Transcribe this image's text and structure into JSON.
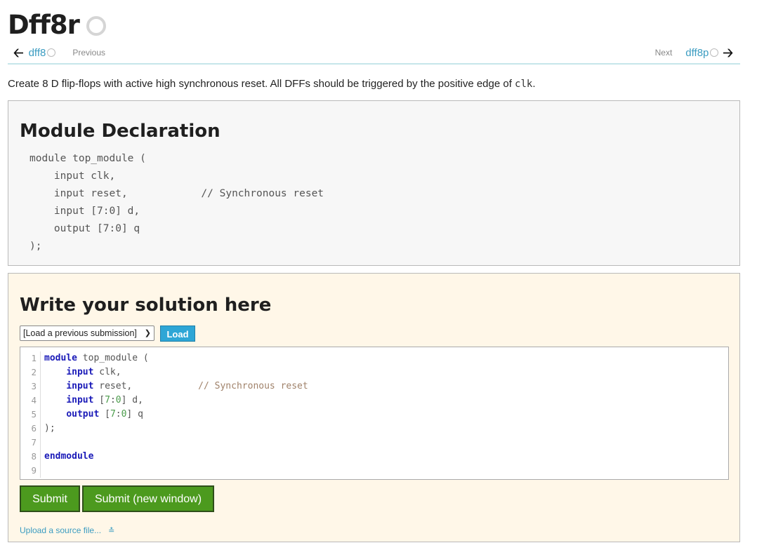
{
  "page": {
    "title": "Dff8r",
    "description": "Create 8 D flip-flops with active high synchronous reset. All DFFs should be triggered by the positive edge of",
    "description_code": "clk",
    "description_end": "."
  },
  "nav": {
    "prev_link": "dff8",
    "prev_label": "Previous",
    "next_label": "Next",
    "next_link": "dff8p"
  },
  "declaration": {
    "heading": "Module Declaration",
    "code": "module top_module (\n    input clk,\n    input reset,            // Synchronous reset\n    input [7:0] d,\n    output [7:0] q\n);"
  },
  "solution": {
    "heading": "Write your solution here",
    "select_value": "[Load a previous submission]",
    "load_label": "Load",
    "line_numbers": [
      "1",
      "2",
      "3",
      "4",
      "5",
      "6",
      "7",
      "8",
      "9"
    ],
    "submit_label": "Submit",
    "submit_new_window_label": "Submit (new window)",
    "upload_label": "Upload a source file..."
  },
  "colors": {
    "link": "#3b9cc1",
    "submit_green": "#4c9a1e",
    "load_blue": "#2ea6d6",
    "solution_bg": "#fff7e8",
    "declaration_bg": "#f7f7f7"
  }
}
